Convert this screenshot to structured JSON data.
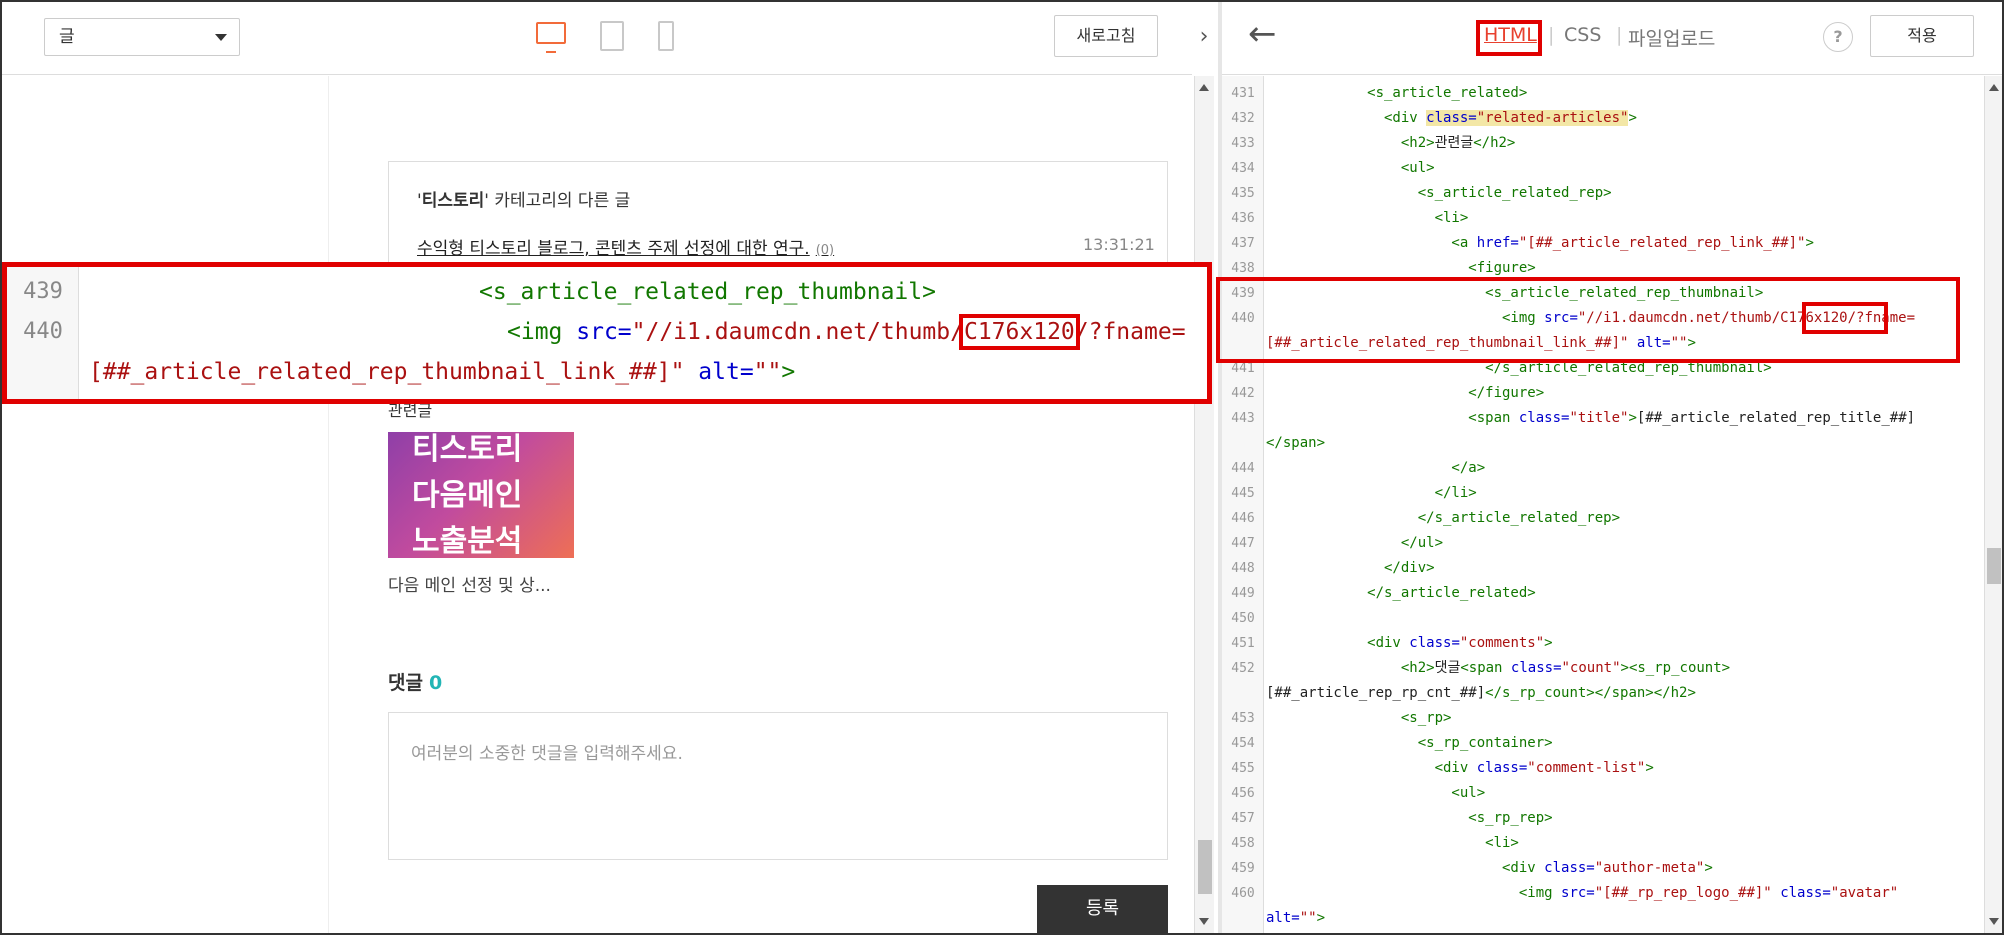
{
  "left": {
    "category_select": "글",
    "refresh_label": "새로고침",
    "collapse_icon": "chevron-right",
    "related": {
      "title_bold": "티스토리",
      "title_rest": "' 카테고리의 다른 글",
      "title_quote": "'",
      "link": "수익형 티스토리 블로그, 콘텐츠 주제 선정에 대한 연구.",
      "count": "(0)",
      "time": "13:31:21"
    },
    "thumb_label": "관련글",
    "thumb_lines": [
      "티스토리",
      "다음메인",
      "노출분석"
    ],
    "thumb_caption": "다음 메인 선정 및 상...",
    "comments_label": "댓글",
    "comments_count": "0",
    "comment_placeholder": "여러분의 소중한 댓글을 입력해주세요.",
    "submit_label": "등록"
  },
  "right": {
    "tabs": {
      "html": "HTML",
      "css": "CSS",
      "upload": "파일업로드",
      "sep": "|"
    },
    "help": "?",
    "apply_label": "적용",
    "lines": [
      {
        "n": "431",
        "parts": [
          [
            "t",
            "            <s_article_related>"
          ]
        ]
      },
      {
        "n": "432",
        "parts": [
          [
            "t",
            "              <div "
          ],
          [
            "a",
            "class="
          ],
          [
            "s",
            "\"related-articles\""
          ],
          [
            "t",
            ">"
          ]
        ]
      },
      {
        "n": "433",
        "parts": [
          [
            "t",
            "                <h2>"
          ],
          [
            "x",
            "관련글"
          ],
          [
            "t",
            "</h2>"
          ]
        ]
      },
      {
        "n": "434",
        "parts": [
          [
            "t",
            "                <ul>"
          ]
        ]
      },
      {
        "n": "435",
        "parts": [
          [
            "t",
            "                  <s_article_related_rep>"
          ]
        ]
      },
      {
        "n": "436",
        "parts": [
          [
            "t",
            "                    <li>"
          ]
        ]
      },
      {
        "n": "437",
        "parts": [
          [
            "t",
            "                      <a "
          ],
          [
            "a",
            "href="
          ],
          [
            "s",
            "\"[##_article_related_rep_link_##]\""
          ],
          [
            "t",
            ">"
          ]
        ]
      },
      {
        "n": "438",
        "parts": [
          [
            "t",
            "                        <figure>"
          ]
        ]
      },
      {
        "n": "439",
        "parts": [
          [
            "t",
            "                          <s_article_related_rep_thumbnail>"
          ]
        ]
      },
      {
        "n": "440",
        "parts": [
          [
            "t",
            "                            <img "
          ],
          [
            "a",
            "src="
          ],
          [
            "s",
            "\"//i1.daumcdn.net/thumb/C176x120/?fname="
          ]
        ]
      },
      {
        "n": "",
        "parts": [
          [
            "s",
            "[##_article_related_rep_thumbnail_link_##]\""
          ],
          [
            "t",
            " "
          ],
          [
            "a",
            "alt="
          ],
          [
            "s",
            "\"\""
          ],
          [
            "t",
            ">"
          ]
        ]
      },
      {
        "n": "441",
        "parts": [
          [
            "t",
            "                          </s_article_related_rep_thumbnail>"
          ]
        ]
      },
      {
        "n": "442",
        "parts": [
          [
            "t",
            "                        </figure>"
          ]
        ]
      },
      {
        "n": "443",
        "parts": [
          [
            "t",
            "                        <span "
          ],
          [
            "a",
            "class="
          ],
          [
            "s",
            "\"title\""
          ],
          [
            "t",
            ">"
          ],
          [
            "x",
            "[##_article_related_rep_title_##]"
          ]
        ]
      },
      {
        "n": "",
        "parts": [
          [
            "t",
            "</span>"
          ]
        ]
      },
      {
        "n": "444",
        "parts": [
          [
            "t",
            "                      </a>"
          ]
        ]
      },
      {
        "n": "445",
        "parts": [
          [
            "t",
            "                    </li>"
          ]
        ]
      },
      {
        "n": "446",
        "parts": [
          [
            "t",
            "                  </s_article_related_rep>"
          ]
        ]
      },
      {
        "n": "447",
        "parts": [
          [
            "t",
            "                </ul>"
          ]
        ]
      },
      {
        "n": "448",
        "parts": [
          [
            "t",
            "              </div>"
          ]
        ]
      },
      {
        "n": "449",
        "parts": [
          [
            "t",
            "            </s_article_related>"
          ]
        ]
      },
      {
        "n": "450",
        "parts": [
          [
            "t",
            ""
          ]
        ]
      },
      {
        "n": "451",
        "parts": [
          [
            "t",
            "            <div "
          ],
          [
            "a",
            "class="
          ],
          [
            "s",
            "\"comments\""
          ],
          [
            "t",
            ">"
          ]
        ]
      },
      {
        "n": "452",
        "parts": [
          [
            "t",
            "                <h2>"
          ],
          [
            "x",
            "댓글"
          ],
          [
            "t",
            "<span "
          ],
          [
            "a",
            "class="
          ],
          [
            "s",
            "\"count\""
          ],
          [
            "t",
            "><s_rp_count>"
          ]
        ]
      },
      {
        "n": "",
        "parts": [
          [
            "x",
            "[##_article_rep_rp_cnt_##]"
          ],
          [
            "t",
            "</s_rp_count></span></h2>"
          ]
        ]
      },
      {
        "n": "453",
        "parts": [
          [
            "t",
            "                <s_rp>"
          ]
        ]
      },
      {
        "n": "454",
        "parts": [
          [
            "t",
            "                  <s_rp_container>"
          ]
        ]
      },
      {
        "n": "455",
        "parts": [
          [
            "t",
            "                    <div "
          ],
          [
            "a",
            "class="
          ],
          [
            "s",
            "\"comment-list\""
          ],
          [
            "t",
            ">"
          ]
        ]
      },
      {
        "n": "456",
        "parts": [
          [
            "t",
            "                      <ul>"
          ]
        ]
      },
      {
        "n": "457",
        "parts": [
          [
            "t",
            "                        <s_rp_rep>"
          ]
        ]
      },
      {
        "n": "458",
        "parts": [
          [
            "t",
            "                          <li>"
          ]
        ]
      },
      {
        "n": "459",
        "parts": [
          [
            "t",
            "                            <div "
          ],
          [
            "a",
            "class="
          ],
          [
            "s",
            "\"author-meta\""
          ],
          [
            "t",
            ">"
          ]
        ]
      },
      {
        "n": "460",
        "parts": [
          [
            "t",
            "                              <img "
          ],
          [
            "a",
            "src="
          ],
          [
            "s",
            "\"[##_rp_rep_logo_##]\""
          ],
          [
            "t",
            " "
          ],
          [
            "a",
            "class="
          ],
          [
            "s",
            "\"avatar\""
          ]
        ]
      },
      {
        "n": "",
        "parts": [
          [
            "a",
            "alt="
          ],
          [
            "s",
            "\"\""
          ],
          [
            "t",
            ">"
          ]
        ]
      }
    ]
  },
  "zoom": {
    "ln1": "439",
    "ln2": "440",
    "line1": "<s_article_related_rep_thumbnail>",
    "line2_tag": "<img ",
    "line2_attr": "src=",
    "line2_str_a": "\"//i1.daumcdn.net/thumb/",
    "line2_hl": "C176x120",
    "line2_str_b": "/?fname=",
    "line3_str": "[##_article_related_rep_thumbnail_link_##]\"",
    "line3_attr": "alt=",
    "line3_str2": "\"\"",
    "line3_end": ">"
  },
  "colors": {
    "accent": "#f26b3a",
    "highlight_red": "#e00000",
    "tag_green": "#117700",
    "attr_blue": "#0000cc",
    "string_red": "#aa1111",
    "count_teal": "#22b5b5"
  }
}
